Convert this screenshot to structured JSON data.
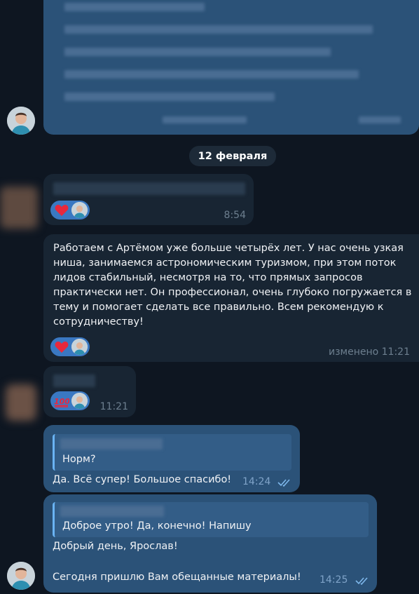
{
  "colors": {
    "background": "#0e1621",
    "incoming_bubble": "#182533",
    "outgoing_bubble": "#2b5278",
    "reaction_pill": "#3a78c2",
    "accent": "#6ab3f3"
  },
  "date_separator": "12 февраля",
  "messages": [
    {
      "direction": "in",
      "time": "8:54",
      "reaction_emoji": "heart-icon"
    },
    {
      "direction": "in",
      "text": "Работаем с Артёмом уже больше четырёх лет. У нас очень узкая ниша, занимаемся астрономическим туризмом, при этом поток лидов стабильный, несмотря на то, что прямых запросов практически нет. Он профессионал, очень глубоко погружается в тему и помогает сделать все правильно. Всем рекомендую к сотрудничеству!",
      "edited_label": "изменено",
      "time": "11:21",
      "reaction_emoji": "heart-icon"
    },
    {
      "direction": "in",
      "time": "11:21",
      "reaction_emoji": "hundred-icon"
    },
    {
      "direction": "out",
      "quote_text": "Норм?",
      "text": "Да. Всё супер! Большое спасибо!",
      "time": "14:24",
      "status": "read"
    },
    {
      "direction": "out",
      "quote_text": "Доброе утро! Да, конечно! Напишу",
      "text_line1": "Добрый день, Ярослав!",
      "text_line2": "Сегодня пришлю Вам обещанные материалы!",
      "time": "14:25",
      "status": "read"
    }
  ]
}
